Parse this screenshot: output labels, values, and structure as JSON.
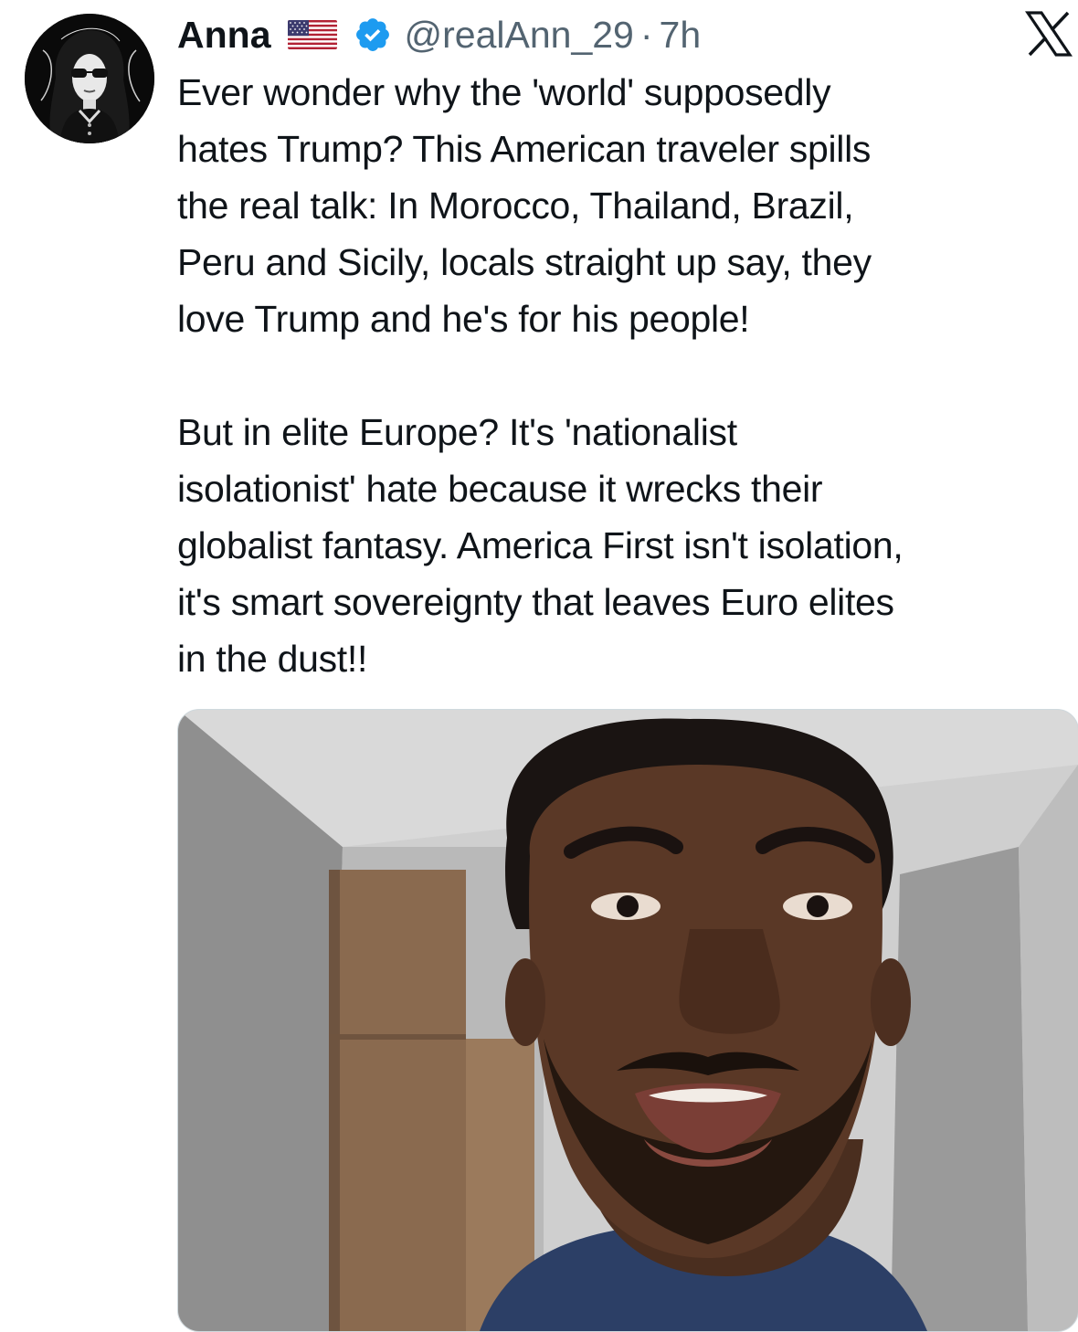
{
  "author": {
    "display_name": "Anna",
    "handle": "@realAnn_29",
    "separator": "·",
    "time": "7h",
    "flag_icon": "us-flag-icon",
    "verified_icon": "verified-badge-icon",
    "verified_color": "#1d9bf0"
  },
  "brand": {
    "icon": "x-logo-icon"
  },
  "tweet": {
    "paragraph_1": "Ever wonder why the 'world' supposedly\nhates Trump? This American traveler spills\nthe real talk: In Morocco, Thailand, Brazil,\nPeru and Sicily, locals straight up say, they\nlove Trump and he's for his people!",
    "paragraph_2": "But in elite Europe? It's 'nationalist\nisolationist' hate because it wrecks their\nglobalist fantasy. America First isn't isolation,\nit's smart sovereignty that leaves Euro elites\nin the dust!!"
  },
  "media": {
    "type": "video-thumbnail"
  },
  "colors": {
    "text": "#0f1419",
    "secondary_text": "#536471",
    "accent": "#1d9bf0"
  }
}
